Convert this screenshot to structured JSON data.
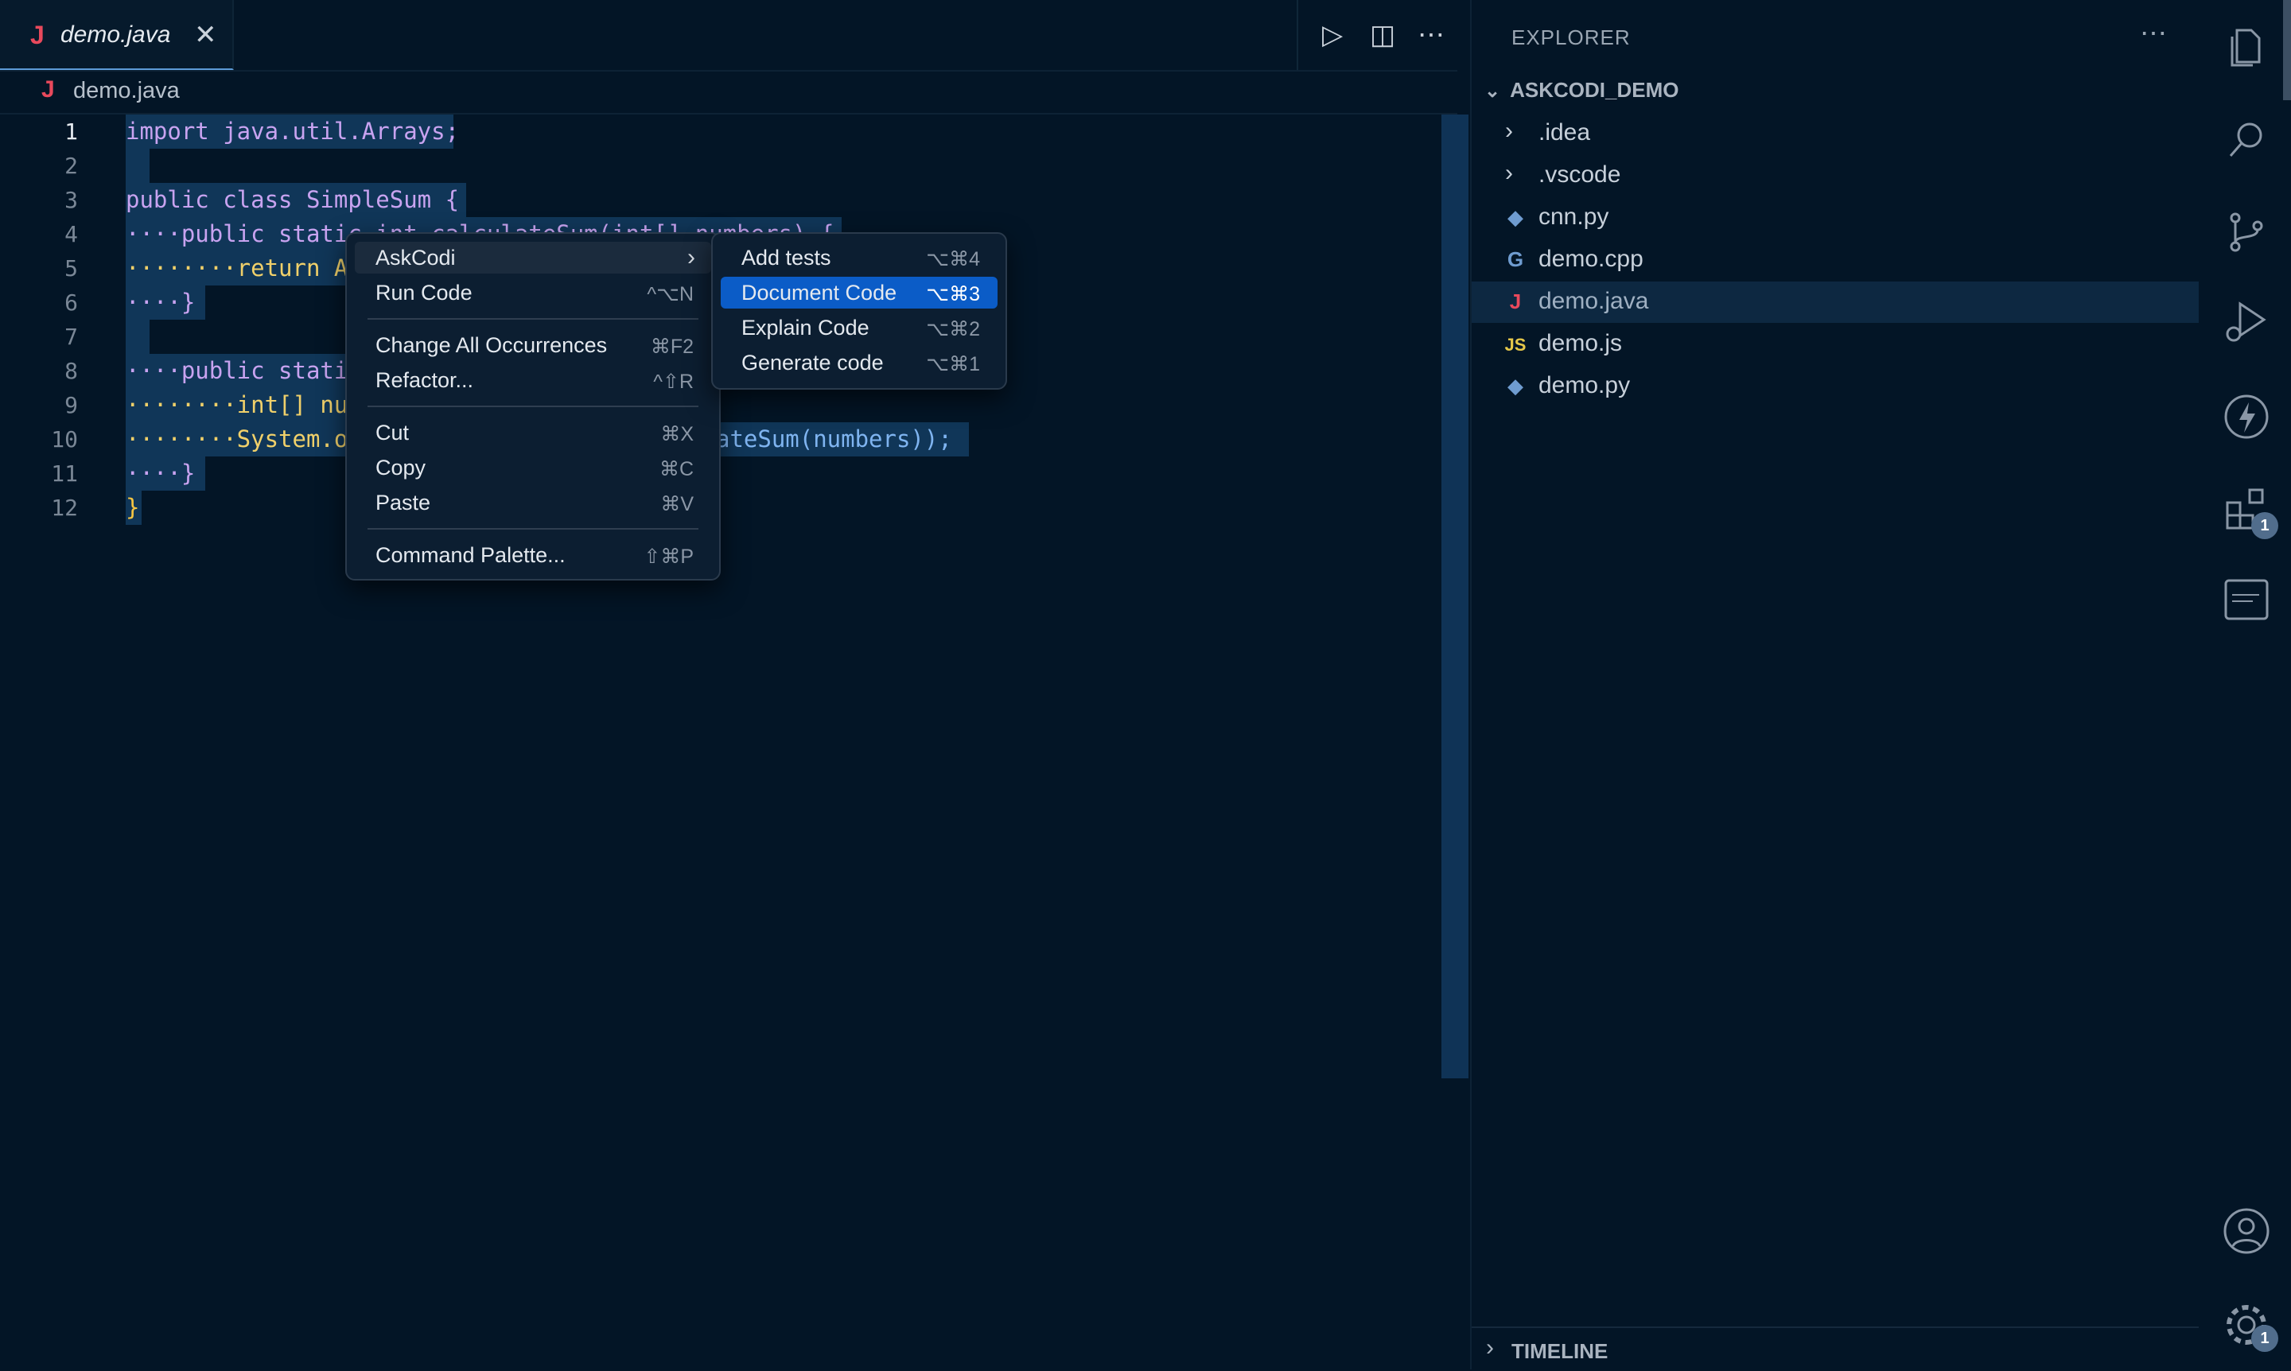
{
  "tab": {
    "icon": "J",
    "name": "demo.java",
    "close": "✕"
  },
  "editor_actions": {
    "run": "▷",
    "split": "◫",
    "more": "⋯"
  },
  "breadcrumb": {
    "icon": "J",
    "file": "demo.java"
  },
  "line_numbers": [
    "1",
    "2",
    "3",
    "4",
    "5",
    "6",
    "7",
    "8",
    "9",
    "10",
    "11",
    "12"
  ],
  "code_lines": [
    "import java.util.Arrays;",
    "",
    "public class SimpleSum {",
    "····public static int calculateSum(int[] numbers) {",
    "········return A",
    "····}",
    "",
    "····public stati",
    "········int[] nu",
    "········System.o",
    "····}",
    "}"
  ],
  "code_tail_line10": "ateSum(numbers));",
  "context_menu": {
    "items": [
      {
        "label": "AskCodi",
        "shortcut": "",
        "submenu": true
      },
      {
        "label": "Run Code",
        "shortcut": "^⌥N"
      },
      {
        "label": "Change All Occurrences",
        "shortcut": "⌘F2"
      },
      {
        "label": "Refactor...",
        "shortcut": "^⇧R"
      },
      {
        "label": "Cut",
        "shortcut": "⌘X"
      },
      {
        "label": "Copy",
        "shortcut": "⌘C"
      },
      {
        "label": "Paste",
        "shortcut": "⌘V"
      },
      {
        "label": "Command Palette...",
        "shortcut": "⇧⌘P"
      }
    ]
  },
  "submenu": {
    "items": [
      {
        "label": "Add tests",
        "shortcut": "⌥⌘4"
      },
      {
        "label": "Document Code",
        "shortcut": "⌥⌘3",
        "selected": true
      },
      {
        "label": "Explain Code",
        "shortcut": "⌥⌘2"
      },
      {
        "label": "Generate code",
        "shortcut": "⌥⌘1"
      }
    ]
  },
  "explorer": {
    "title": "EXPLORER",
    "more": "⋯",
    "project": "ASKCODI_DEMO",
    "entries": [
      {
        "name": ".idea",
        "type": "folder"
      },
      {
        "name": ".vscode",
        "type": "folder"
      },
      {
        "name": "cnn.py",
        "type": "python"
      },
      {
        "name": "demo.cpp",
        "type": "cpp"
      },
      {
        "name": "demo.java",
        "type": "java",
        "active": true
      },
      {
        "name": "demo.js",
        "type": "js"
      },
      {
        "name": "demo.py",
        "type": "python"
      }
    ],
    "timeline": "TIMELINE"
  },
  "activity_bar": {
    "extensions_badge": "1",
    "settings_badge": "1"
  },
  "colors": {
    "background": "#031526",
    "selection": "#103658",
    "menu_highlight": "#0b5cc7",
    "java_icon": "#e8495c"
  }
}
